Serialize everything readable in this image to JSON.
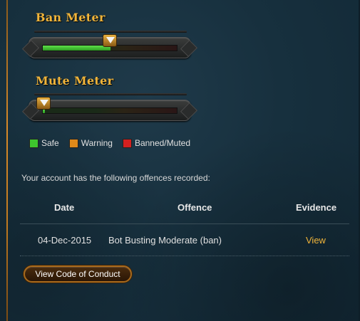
{
  "ban_meter": {
    "title": "Ban Meter",
    "level": 0.5
  },
  "mute_meter": {
    "title": "Mute Meter",
    "level": 0.0
  },
  "legend": [
    {
      "label": "Safe",
      "color": "#3ec62e"
    },
    {
      "label": "Warning",
      "color": "#e08a1a"
    },
    {
      "label": "Banned/Muted",
      "color": "#d42020"
    }
  ],
  "offences": {
    "intro": "Your account has the following offences recorded:",
    "headers": {
      "date": "Date",
      "offence": "Offence",
      "evidence": "Evidence"
    },
    "rows": [
      {
        "date": "04-Dec-2015",
        "offence": "Bot Busting Moderate (ban)",
        "evidence": "View"
      }
    ]
  },
  "code_of_conduct_button": "View Code of Conduct",
  "colors": {
    "accent_gold": "#f0b43a",
    "background": "#17303e"
  }
}
